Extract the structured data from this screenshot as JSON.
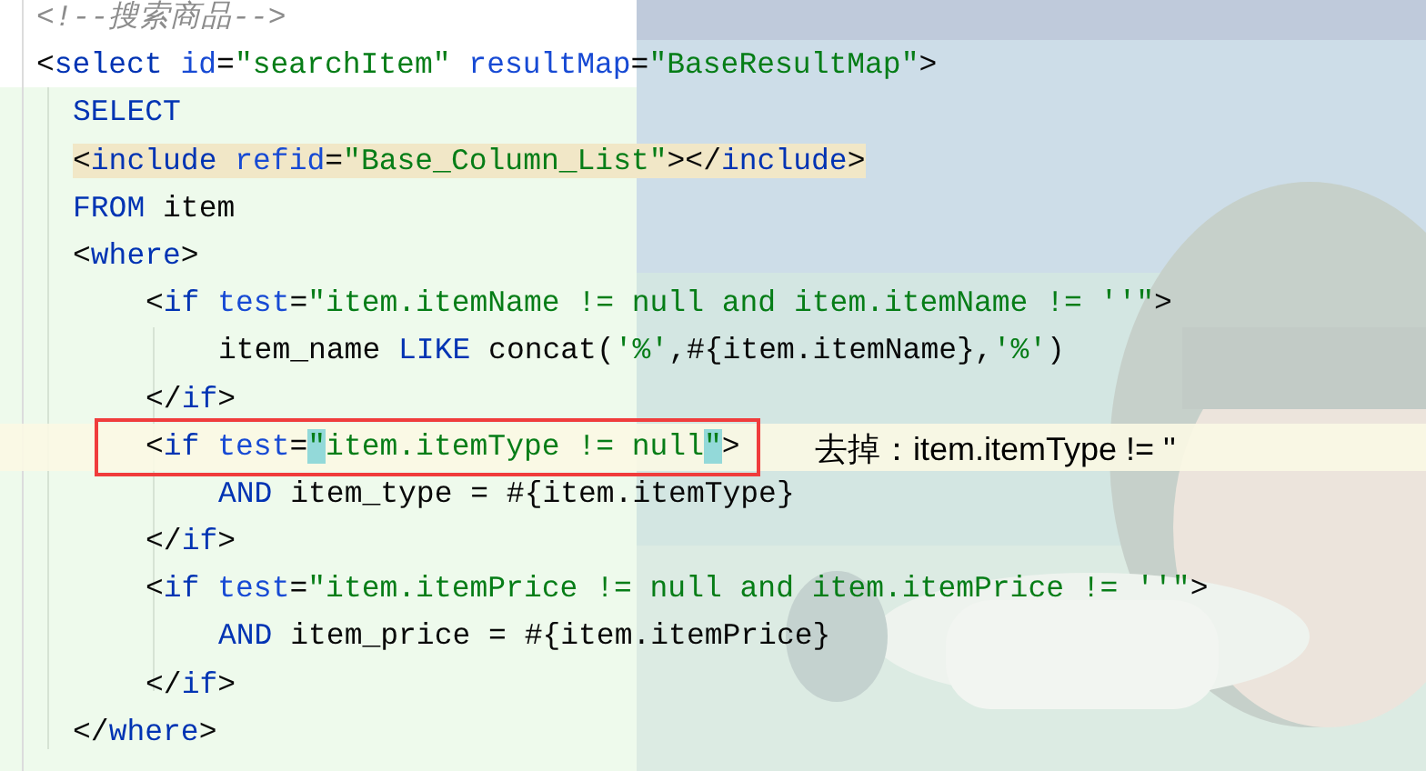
{
  "editor": {
    "lines": [
      {
        "tokens": [
          {
            "kind": "comment",
            "text": "<!--搜索商品-->"
          }
        ]
      },
      {
        "tokens": [
          {
            "kind": "punct",
            "text": "<"
          },
          {
            "kind": "tag",
            "text": "select "
          },
          {
            "kind": "attr",
            "text": "id"
          },
          {
            "kind": "punct",
            "text": "="
          },
          {
            "kind": "string",
            "text": "\"searchItem\" "
          },
          {
            "kind": "attr",
            "text": "resultMap"
          },
          {
            "kind": "punct",
            "text": "="
          },
          {
            "kind": "string",
            "text": "\"BaseResultMap\""
          },
          {
            "kind": "punct",
            "text": ">"
          }
        ],
        "children": [
          {
            "tokens": [
              {
                "kind": "keyword",
                "text": "SELECT"
              }
            ]
          },
          {
            "usage_highlight": true,
            "tokens": [
              {
                "kind": "punct",
                "text": "<"
              },
              {
                "kind": "tag",
                "text": "include "
              },
              {
                "kind": "attr",
                "text": "refid"
              },
              {
                "kind": "punct",
                "text": "="
              },
              {
                "kind": "string",
                "text": "\"Base_Column_List\""
              },
              {
                "kind": "punct",
                "text": "></"
              },
              {
                "kind": "tag",
                "text": "include"
              },
              {
                "kind": "punct",
                "text": ">"
              }
            ]
          },
          {
            "tokens": [
              {
                "kind": "keyword",
                "text": "FROM "
              },
              {
                "kind": "plain",
                "text": "item"
              }
            ]
          },
          {
            "tokens": [
              {
                "kind": "punct",
                "text": "<"
              },
              {
                "kind": "tag",
                "text": "where"
              },
              {
                "kind": "punct",
                "text": ">"
              }
            ],
            "children": [
              {
                "tokens": [
                  {
                    "kind": "punct",
                    "text": "<"
                  },
                  {
                    "kind": "tag",
                    "text": "if "
                  },
                  {
                    "kind": "attr",
                    "text": "test"
                  },
                  {
                    "kind": "punct",
                    "text": "="
                  },
                  {
                    "kind": "string",
                    "text": "\"item.itemName != null and item.itemName != ''\""
                  },
                  {
                    "kind": "punct",
                    "text": ">"
                  }
                ],
                "children": [
                  {
                    "tokens": [
                      {
                        "kind": "plain",
                        "text": "item_name "
                      },
                      {
                        "kind": "keyword",
                        "text": "LIKE "
                      },
                      {
                        "kind": "plain",
                        "text": "concat("
                      },
                      {
                        "kind": "string",
                        "text": "'%'"
                      },
                      {
                        "kind": "plain",
                        "text": ",#{item.itemName},"
                      },
                      {
                        "kind": "string",
                        "text": "'%'"
                      },
                      {
                        "kind": "plain",
                        "text": ")"
                      }
                    ]
                  }
                ]
              },
              {
                "tokens": [
                  {
                    "kind": "punct",
                    "text": "</"
                  },
                  {
                    "kind": "tag",
                    "text": "if"
                  },
                  {
                    "kind": "punct",
                    "text": ">"
                  }
                ]
              },
              {
                "caret_line": true,
                "tokens": [
                  {
                    "kind": "punct",
                    "text": "<"
                  },
                  {
                    "kind": "tag",
                    "text": "if "
                  },
                  {
                    "kind": "attr",
                    "text": "test"
                  },
                  {
                    "kind": "punct",
                    "text": "="
                  },
                  {
                    "kind": "match",
                    "text": "\""
                  },
                  {
                    "kind": "string",
                    "text": "item.itemType != null"
                  },
                  {
                    "kind": "match",
                    "text": "\""
                  },
                  {
                    "kind": "punct",
                    "text": ">"
                  }
                ],
                "children": [
                  {
                    "tokens": [
                      {
                        "kind": "keyword",
                        "text": "AND "
                      },
                      {
                        "kind": "plain",
                        "text": "item_type = #{item.itemType}"
                      }
                    ]
                  }
                ]
              },
              {
                "tokens": [
                  {
                    "kind": "punct",
                    "text": "</"
                  },
                  {
                    "kind": "tag",
                    "text": "if"
                  },
                  {
                    "kind": "punct",
                    "text": ">"
                  }
                ]
              },
              {
                "tokens": [
                  {
                    "kind": "punct",
                    "text": "<"
                  },
                  {
                    "kind": "tag",
                    "text": "if "
                  },
                  {
                    "kind": "attr",
                    "text": "test"
                  },
                  {
                    "kind": "punct",
                    "text": "="
                  },
                  {
                    "kind": "string",
                    "text": "\"item.itemPrice != null and item.itemPrice != ''\""
                  },
                  {
                    "kind": "punct",
                    "text": ">"
                  }
                ],
                "children": [
                  {
                    "tokens": [
                      {
                        "kind": "keyword",
                        "text": "AND "
                      },
                      {
                        "kind": "plain",
                        "text": "item_price = #{item.itemPrice}"
                      }
                    ]
                  }
                ]
              },
              {
                "tokens": [
                  {
                    "kind": "punct",
                    "text": "</"
                  },
                  {
                    "kind": "tag",
                    "text": "if"
                  },
                  {
                    "kind": "punct",
                    "text": ">"
                  }
                ]
              }
            ]
          },
          {
            "tokens": [
              {
                "kind": "punct",
                "text": "</"
              },
              {
                "kind": "tag",
                "text": "where"
              },
              {
                "kind": "punct",
                "text": ">"
              }
            ]
          }
        ]
      }
    ]
  },
  "annotation": {
    "text": "去掉：item.itemType != ''"
  }
}
